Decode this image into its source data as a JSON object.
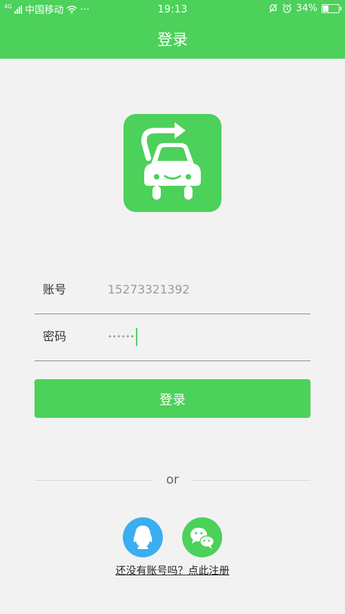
{
  "status_bar": {
    "network_type": "4G",
    "carrier": "中国移动",
    "dots": "···",
    "time": "19:13",
    "battery": "34%"
  },
  "header": {
    "title": "登录"
  },
  "form": {
    "account_label": "账号",
    "account_value": "15273321392",
    "password_label": "密码",
    "password_value": "••••••"
  },
  "login_button": {
    "label": "登录"
  },
  "divider": {
    "text": "or"
  },
  "social": [
    {
      "name": "qq",
      "icon": "qq-icon",
      "color": "#3aaef0"
    },
    {
      "name": "wechat",
      "icon": "wechat-icon",
      "color": "#4cd15a"
    }
  ],
  "register_link": "还没有账号吗？点此注册",
  "colors": {
    "primary": "#4cd15a",
    "background": "#f2f2f2"
  }
}
